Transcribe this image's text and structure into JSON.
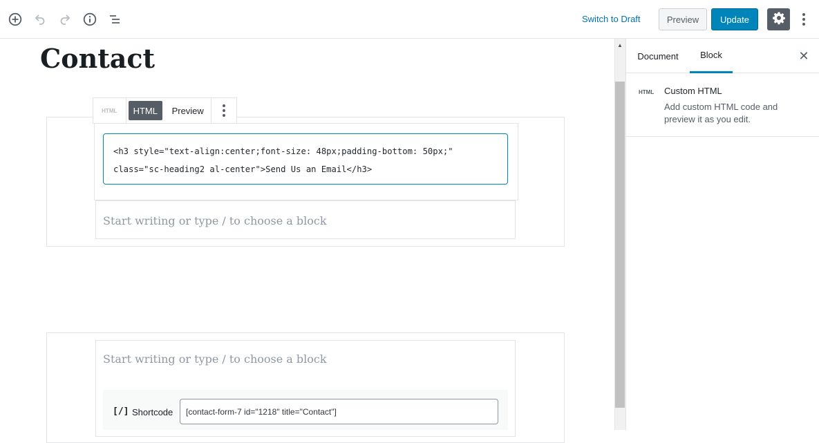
{
  "header": {
    "add_icon": "circle-plus-icon",
    "undo_icon": "undo-icon",
    "redo_icon": "redo-icon",
    "info_icon": "info-icon",
    "outline_icon": "list-icon",
    "switch_to_draft": "Switch to Draft",
    "preview": "Preview",
    "update": "Update",
    "settings_icon": "gear-icon",
    "more_icon": "vertical-ellipsis-icon"
  },
  "editor": {
    "title": "Contact",
    "html_block": {
      "icon_label": "HTML",
      "tab_html": "HTML",
      "tab_preview": "Preview",
      "code_line1": "<h3 style=\"text-align:center;font-size: 48px;padding-bottom: 50px;\"",
      "code_line2": "class=\"sc-heading2 al-center\">Send Us an Email</h3>"
    },
    "placeholder_1": "Start writing or type / to choose a block",
    "placeholder_2": "Start writing or type / to choose a block",
    "shortcode": {
      "icon": "[/]",
      "label": "Shortcode",
      "value": "[contact-form-7 id=\"1218\" title=\"Contact\"]"
    }
  },
  "sidebar": {
    "tabs": [
      "Document",
      "Block"
    ],
    "active_tab": "Block",
    "close_icon": "close-icon",
    "block": {
      "icon_label": "HTML",
      "title": "Custom HTML",
      "description": "Add custom HTML code and preview it as you edit."
    }
  },
  "colors": {
    "accent": "#0085ba",
    "link": "#0073aa",
    "dark_button": "#555d66"
  }
}
